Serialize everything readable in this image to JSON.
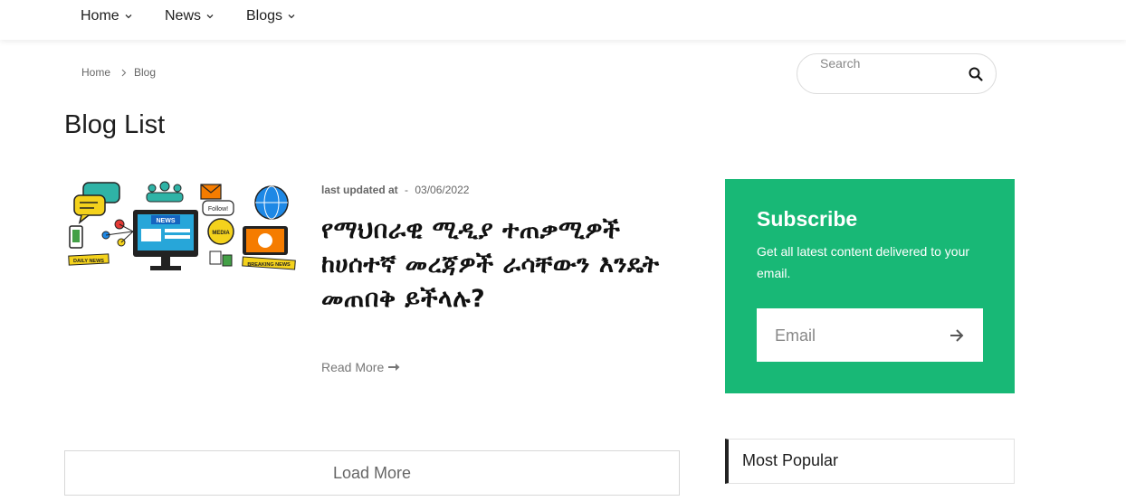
{
  "nav": {
    "items": [
      {
        "label": "Home"
      },
      {
        "label": "News"
      },
      {
        "label": "Blogs"
      }
    ]
  },
  "breadcrumb": {
    "home": "Home",
    "current": "Blog"
  },
  "search": {
    "placeholder": "Search"
  },
  "page": {
    "title": "Blog List"
  },
  "post": {
    "meta_label": "last updated at",
    "meta_sep": "-",
    "date": "03/06/2022",
    "title": "የማህበራዊ ሚዲያ ተጠቃሚዎች ከሀሰተኛ መረጃዎች ራሳቸውን እንዴት መጠበቅ ይችላሉ?",
    "read_more": "Read More",
    "thumb_labels": {
      "news": "NEWS",
      "media": "MEDIA",
      "follow": "Follow!",
      "daily": "DAILY NEWS",
      "breaking": "BREAKING NEWS"
    }
  },
  "load_more": "Load More",
  "subscribe": {
    "title": "Subscribe",
    "text": "Get all latest content delivered to your email.",
    "email_placeholder": "Email"
  },
  "sidebar": {
    "most_popular": "Most Popular"
  },
  "colors": {
    "accent": "#18b876"
  }
}
